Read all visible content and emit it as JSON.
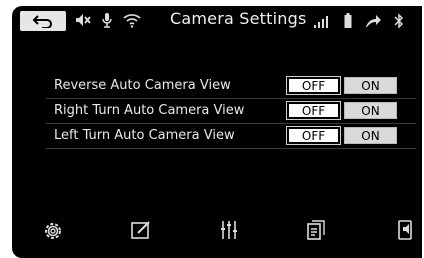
{
  "header": {
    "title": "Camera Settings",
    "back_icon": "back-arrow-icon",
    "status_icons_left": [
      "mute-icon",
      "microphone-icon",
      "wifi-icon"
    ],
    "status_icons_right": [
      "signal-icon",
      "battery-icon",
      "charging-icon",
      "bluetooth-icon"
    ]
  },
  "settings": [
    {
      "label": "Reverse Auto Camera View",
      "off": "OFF",
      "on": "ON"
    },
    {
      "label": "Right Turn Auto Camera View",
      "off": "OFF",
      "on": "ON"
    },
    {
      "label": "Left Turn Auto Camera View",
      "off": "OFF",
      "on": "ON"
    }
  ],
  "bottom_bar": {
    "icons": [
      "gear-icon",
      "edit-icon",
      "equalizer-icon",
      "document-icon",
      "phone-mirror-icon"
    ]
  },
  "colors": {
    "background": "#000000",
    "text": "#e9e9e9",
    "button_on": "#d9d9d9",
    "button_off": "#ffffff"
  }
}
